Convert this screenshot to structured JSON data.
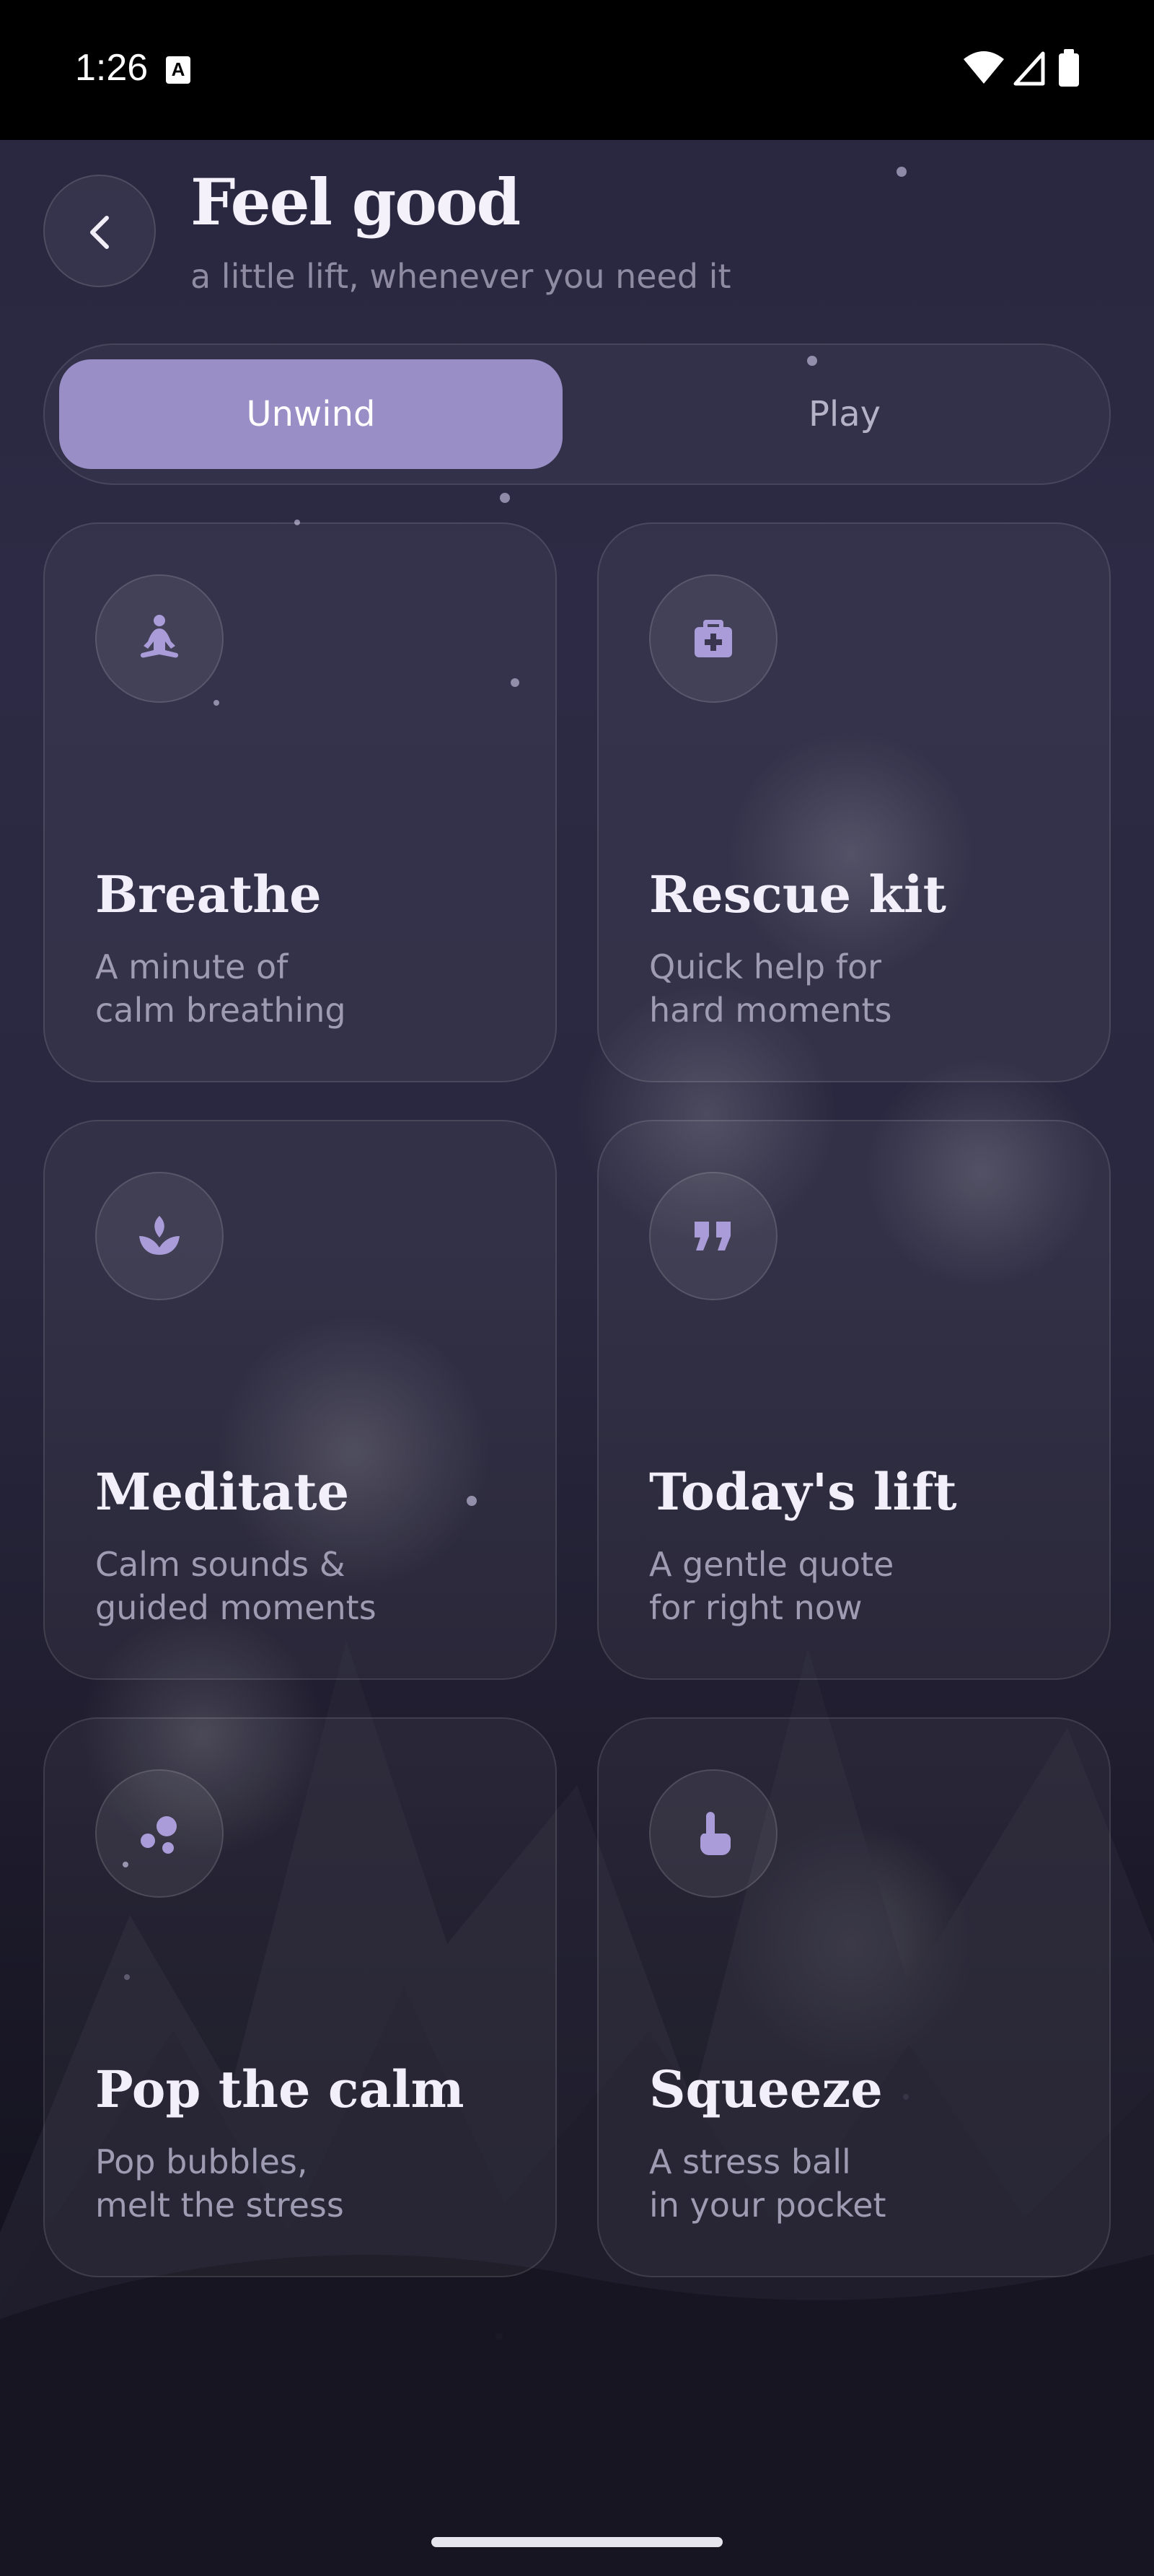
{
  "status_bar": {
    "time": "1:26",
    "badge": "A"
  },
  "header": {
    "back_icon": "chevron-left-icon",
    "title": "Feel good",
    "subtitle": "a little lift, whenever you need it"
  },
  "tabs": [
    {
      "label": "Unwind",
      "selected": true
    },
    {
      "label": "Play",
      "selected": false
    }
  ],
  "cards": [
    {
      "title": "Breathe",
      "description": "A minute of\ncalm breathing",
      "icon": "meditation-person-icon"
    },
    {
      "title": "Rescue kit",
      "description": "Quick help for\nhard moments",
      "icon": "first-aid-kit-icon"
    },
    {
      "title": "Meditate",
      "description": "Calm sounds &\nguided moments",
      "icon": "lotus-icon"
    },
    {
      "title": "Today's lift",
      "description": "A gentle quote\nfor right now",
      "icon": "quote-icon"
    },
    {
      "title": "Pop the calm",
      "description": "Pop bubbles,\nmelt the stress",
      "icon": "bubbles-icon"
    },
    {
      "title": "Squeeze",
      "description": "A stress ball\nin your pocket",
      "icon": "hand-pointer-icon"
    }
  ],
  "colors": {
    "accent": "#9a8ec6",
    "icon": "#a99cd8",
    "background": "#2a2740"
  }
}
